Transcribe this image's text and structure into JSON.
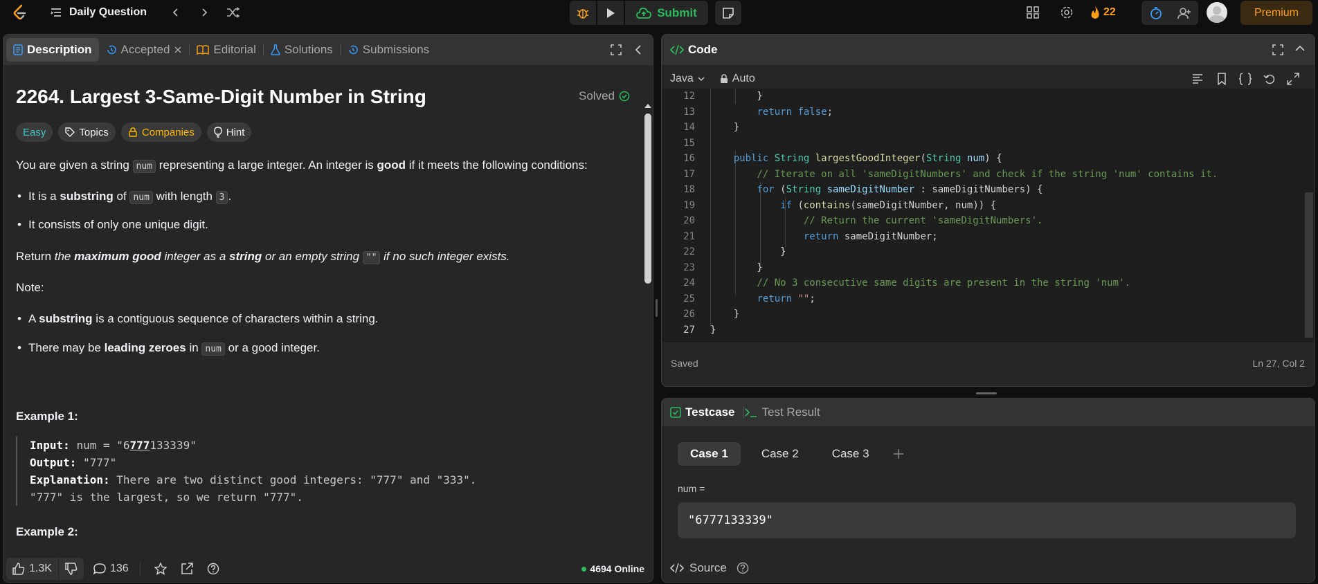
{
  "topbar": {
    "daily_label": "Daily Question",
    "submit_label": "Submit",
    "streak_count": "22",
    "premium_label": "Premium"
  },
  "left_tabs": [
    {
      "label": "Description",
      "icon": "document-icon"
    },
    {
      "label": "Accepted",
      "icon": "history-icon"
    },
    {
      "label": "Editorial",
      "icon": "book-icon"
    },
    {
      "label": "Solutions",
      "icon": "flask-icon"
    },
    {
      "label": "Submissions",
      "icon": "history-icon"
    }
  ],
  "problem": {
    "title": "2264. Largest 3-Same-Digit Number in String",
    "solved_label": "Solved",
    "tags": {
      "difficulty": "Easy",
      "topics": "Topics",
      "companies": "Companies",
      "hint": "Hint"
    },
    "intro": {
      "a": "You are given a string ",
      "code": "num",
      "b": " representing a large integer. An integer is ",
      "good": "good",
      "c": " if it meets the following conditions:"
    },
    "cond1": {
      "a": "It is a ",
      "b": "substring",
      "c": " of ",
      "code": "num",
      "d": " with length ",
      "len": "3",
      "e": "."
    },
    "cond2": "It consists of only one unique digit.",
    "ret": {
      "a": "Return ",
      "b": "the ",
      "c": "maximum good",
      "d": " integer as a ",
      "e": "string",
      "f": " or an empty string ",
      "code": "\"\"",
      "g": " if no such integer exists."
    },
    "note": "Note:",
    "note1": {
      "a": "A ",
      "b": "substring",
      "c": " is a contiguous sequence of characters within a string."
    },
    "note2": {
      "a": "There may be ",
      "b": "leading zeroes",
      "c": " in ",
      "code": "num",
      "d": " or a good integer."
    },
    "example1": {
      "title": "Example 1:",
      "input_label": "Input:",
      "input_pre": "num = \"6",
      "input_u": "777",
      "input_post": "133339\"",
      "output_label": "Output:",
      "output": "\"777\"",
      "expl_label": "Explanation:",
      "expl1": "There are two distinct good integers: \"777\" and \"333\".",
      "expl2": "\"777\" is the largest, so we return \"777\"."
    },
    "example2_title": "Example 2:"
  },
  "bottombar": {
    "likes": "1.3K",
    "comments": "136",
    "online": "4694 Online"
  },
  "code_panel": {
    "title": "Code",
    "language": "Java",
    "mode": "Auto",
    "saved": "Saved",
    "position": "Ln 27, Col 2",
    "lines": [
      {
        "n": "12",
        "t": "        }"
      },
      {
        "n": "13",
        "t": "        return false;"
      },
      {
        "n": "14",
        "t": "    }"
      },
      {
        "n": "15",
        "t": ""
      },
      {
        "n": "16",
        "t": "    public String largestGoodInteger(String num) {"
      },
      {
        "n": "17",
        "t": "        // Iterate on all 'sameDigitNumbers' and check if the string 'num' contains it."
      },
      {
        "n": "18",
        "t": "        for (String sameDigitNumber : sameDigitNumbers) {"
      },
      {
        "n": "19",
        "t": "            if (contains(sameDigitNumber, num)) {"
      },
      {
        "n": "20",
        "t": "                // Return the current 'sameDigitNumbers'."
      },
      {
        "n": "21",
        "t": "                return sameDigitNumber;"
      },
      {
        "n": "22",
        "t": "            }"
      },
      {
        "n": "23",
        "t": "        }"
      },
      {
        "n": "24",
        "t": "        // No 3 consecutive same digits are present in the string 'num'."
      },
      {
        "n": "25",
        "t": "        return \"\";"
      },
      {
        "n": "26",
        "t": "    }"
      },
      {
        "n": "27",
        "t": "}"
      }
    ]
  },
  "test_panel": {
    "tab_testcase": "Testcase",
    "tab_result": "Test Result",
    "cases": [
      "Case 1",
      "Case 2",
      "Case 3"
    ],
    "param_label": "num =",
    "param_value": "\"6777133339\"",
    "source_label": "Source"
  },
  "colors": {
    "accent": "#ffa116",
    "success": "#2cbb5d",
    "easy": "#46c6c2"
  }
}
